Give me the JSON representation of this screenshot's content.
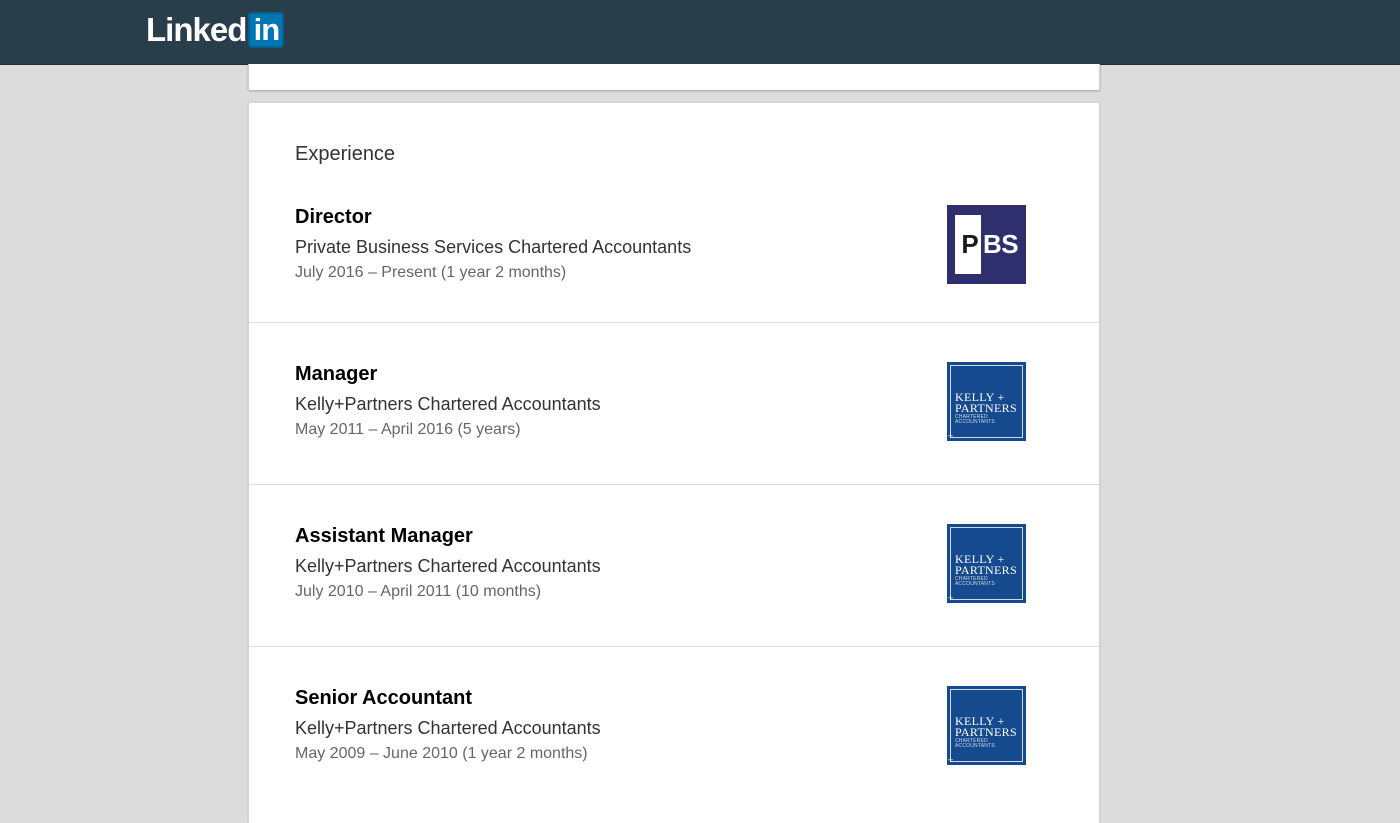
{
  "header": {
    "logo_text": "Linked",
    "logo_in": "in",
    "bg_color": "#283e4a",
    "accent": "#0077b5"
  },
  "experience": {
    "section_title": "Experience",
    "items": [
      {
        "title": "Director",
        "company": "Private Business Services Chartered Accountants",
        "dates": "July 2016 – Present (1 year 2 months)",
        "logo": {
          "type": "pbs",
          "letter": "P",
          "text": "BS",
          "color": "#2e2f6c"
        }
      },
      {
        "title": "Manager",
        "company": "Kelly+Partners Chartered Accountants",
        "dates": "May 2011 – April 2016 (5 years)",
        "logo": {
          "type": "kelly-partners",
          "line1": "KELLY +",
          "line2": "PARTNERS",
          "line3": "CHARTERED ACCOUNTANTS",
          "color": "#154a8f"
        }
      },
      {
        "title": "Assistant Manager",
        "company": "Kelly+Partners Chartered Accountants",
        "dates": "July 2010 – April 2011 (10 months)",
        "logo": {
          "type": "kelly-partners",
          "line1": "KELLY +",
          "line2": "PARTNERS",
          "line3": "CHARTERED ACCOUNTANTS",
          "color": "#154a8f"
        }
      },
      {
        "title": "Senior Accountant",
        "company": "Kelly+Partners Chartered Accountants",
        "dates": "May 2009 – June 2010 (1 year 2 months)",
        "logo": {
          "type": "kelly-partners",
          "line1": "KELLY +",
          "line2": "PARTNERS",
          "line3": "CHARTERED ACCOUNTANTS",
          "color": "#154a8f"
        }
      }
    ]
  }
}
